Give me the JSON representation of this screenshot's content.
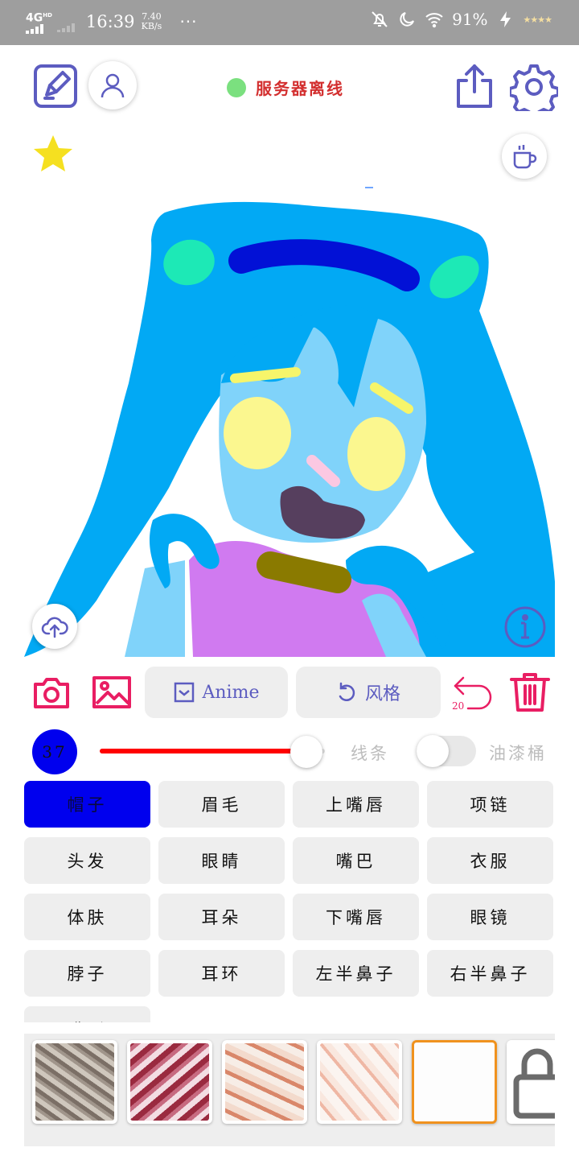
{
  "status_bar": {
    "network": "4G",
    "network_sup": "HD",
    "time": "16:39",
    "speed_value": "7.40",
    "speed_unit": "KB/s",
    "more": "···",
    "battery": "91%",
    "icons": [
      "mute-bell-icon",
      "moon-icon",
      "wifi-icon",
      "charging-bolt-icon"
    ]
  },
  "toolbar": {
    "server_status": "服务器离线",
    "server_status_color": "#7be07f",
    "icons": [
      "edit-pen-icon",
      "user-icon",
      "share-upload-icon",
      "settings-gear-icon",
      "star-icon",
      "coffee-cup-icon"
    ]
  },
  "canvas": {
    "icons": [
      "cloud-upload-icon",
      "info-icon"
    ]
  },
  "actions": {
    "anime_label": "Anime",
    "style_label": "风格",
    "undo_count": "20",
    "icons": [
      "camera-icon",
      "image-icon",
      "check-box-icon",
      "rotate-left-icon",
      "undo-icon",
      "trash-icon"
    ]
  },
  "brush": {
    "size": "37",
    "slider_fraction": 0.91,
    "mode_line": "线条",
    "mode_bucket": "油漆桶",
    "bucket_enabled": false
  },
  "parts": {
    "selected": "帽子",
    "items": [
      "帽子",
      "眉毛",
      "上嘴唇",
      "项链",
      "头发",
      "眼睛",
      "嘴巴",
      "衣服",
      "体肤",
      "耳朵",
      "下嘴唇",
      "眼镜",
      "脖子",
      "耳环",
      "左半鼻子",
      "右半鼻子",
      "嘴形"
    ]
  },
  "textures": {
    "selected_index": 4,
    "items": [
      "texture-1",
      "texture-2",
      "texture-3",
      "texture-4",
      "texture-5",
      "texture-locked"
    ]
  },
  "colors": {
    "accent": "#5c5cc0",
    "danger": "#e91e63",
    "selected": "#0000ee",
    "slider": "#ff0000",
    "texture_selected_border": "#f0921e"
  }
}
